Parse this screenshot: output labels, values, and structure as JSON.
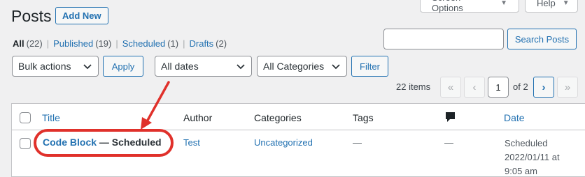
{
  "header": {
    "title": "Posts",
    "add_new_label": "Add New",
    "screen_options_label": "Screen Options",
    "help_label": "Help"
  },
  "filters": {
    "views": [
      {
        "label": "All",
        "count": "(22)"
      },
      {
        "label": "Published",
        "count": "(19)"
      },
      {
        "label": "Scheduled",
        "count": "(1)"
      },
      {
        "label": "Drafts",
        "count": "(2)"
      }
    ],
    "separator": "|",
    "bulk_actions_value": "Bulk actions",
    "apply_label": "Apply",
    "dates_value": "All dates",
    "categories_value": "All Categories",
    "filter_label": "Filter"
  },
  "search": {
    "value": "",
    "button_label": "Search Posts"
  },
  "pagination": {
    "items_text": "22 items",
    "first_symbol": "«",
    "prev_symbol": "‹",
    "current_page": "1",
    "of_text": "of 2",
    "next_symbol": "›",
    "last_symbol": "»"
  },
  "table": {
    "columns": {
      "title": "Title",
      "author": "Author",
      "categories": "Categories",
      "tags": "Tags",
      "comments_icon": "comment-bubble-icon",
      "date": "Date"
    },
    "rows": [
      {
        "title": "Code Block",
        "state": " — Scheduled",
        "author": "Test",
        "categories": "Uncategorized",
        "tags": "—",
        "comments": "—",
        "date_status": "Scheduled",
        "date_line1": "2022/01/11 at",
        "date_line2": "9:05 am"
      }
    ]
  },
  "colors": {
    "accent": "#2271b1",
    "annotation": "#e0312b",
    "background": "#f0f0f1"
  }
}
